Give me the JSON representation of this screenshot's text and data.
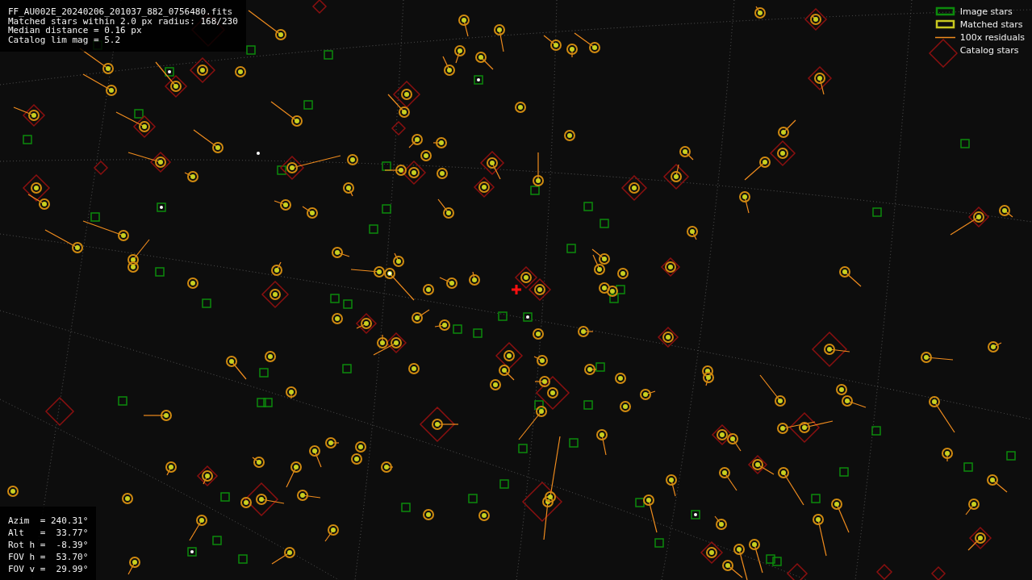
{
  "info_top": {
    "lines": [
      "FF_AU002E_20240206_201037_882_0756480.fits",
      "Matched stars within 2.0 px radius: 168/230",
      "Median distance = 0.16 px",
      "Catalog lim mag = 5.2"
    ]
  },
  "info_bottom": {
    "lines": [
      "Azim  = 240.31°",
      "Alt   =  33.77°",
      "Rot h =  -8.39°",
      "FOV h =  53.70°",
      "FOV v =  29.99°"
    ]
  },
  "legend": [
    {
      "kind": "image",
      "label": "Image stars"
    },
    {
      "kind": "matched",
      "label": "Matched stars"
    },
    {
      "kind": "residual",
      "label": "100x residuals"
    },
    {
      "kind": "catalog",
      "label": "Catalog stars"
    }
  ]
}
